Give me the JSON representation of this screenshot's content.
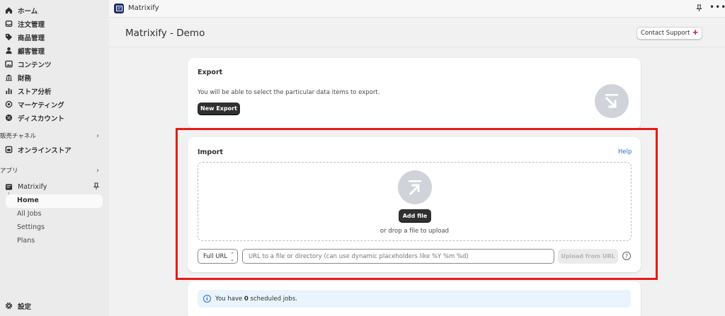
{
  "sidebar": {
    "items": [
      {
        "label": "ホーム",
        "icon": "home-icon"
      },
      {
        "label": "注文管理",
        "icon": "inbox-icon"
      },
      {
        "label": "商品管理",
        "icon": "tag-icon"
      },
      {
        "label": "顧客管理",
        "icon": "person-icon"
      },
      {
        "label": "コンテンツ",
        "icon": "image-icon"
      },
      {
        "label": "財務",
        "icon": "bank-icon"
      },
      {
        "label": "ストア分析",
        "icon": "bar-chart-icon"
      },
      {
        "label": "マーケティング",
        "icon": "target-icon"
      },
      {
        "label": "ディスカウント",
        "icon": "discount-icon"
      }
    ],
    "sales_channels_label": "販売チャネル",
    "online_store_label": "オンラインストア",
    "apps_label": "アプリ",
    "app_name": "Matrixify",
    "app_subitems": [
      "Home",
      "All Jobs",
      "Settings",
      "Plans"
    ],
    "settings_label": "設定"
  },
  "topbar": {
    "app_title": "Matrixify",
    "more_label": "•••"
  },
  "page": {
    "title": "Matrixify - Demo",
    "contact_label": "Contact Support"
  },
  "export": {
    "title": "Export",
    "description": "You will be able to select the particular data items to export.",
    "button_label": "New Export"
  },
  "import": {
    "title": "Import",
    "help_label": "Help",
    "add_file_label": "Add file",
    "drop_text": "or drop a file to upload",
    "url_type_value": "Full URL",
    "url_placeholder": "URL to a file or directory (can use dynamic placeholders like %Y %m %d)",
    "upload_button_label": "Upload from URL",
    "help_icon_label": "?"
  },
  "jobs": {
    "prefix": "You have",
    "count": "0",
    "suffix": "scheduled jobs."
  },
  "colors": {
    "highlight": "#e31b1b",
    "link": "#2c6ecb",
    "app_icon": "#1d2e6b"
  }
}
